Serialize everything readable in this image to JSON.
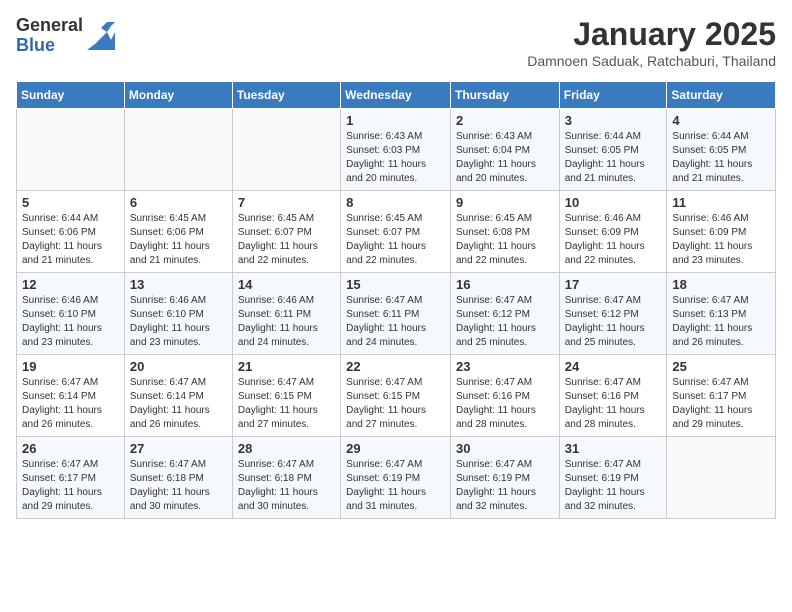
{
  "header": {
    "logo_general": "General",
    "logo_blue": "Blue",
    "month_title": "January 2025",
    "location": "Damnoen Saduak, Ratchaburi, Thailand"
  },
  "days_of_week": [
    "Sunday",
    "Monday",
    "Tuesday",
    "Wednesday",
    "Thursday",
    "Friday",
    "Saturday"
  ],
  "weeks": [
    [
      {
        "day": "",
        "info": ""
      },
      {
        "day": "",
        "info": ""
      },
      {
        "day": "",
        "info": ""
      },
      {
        "day": "1",
        "info": "Sunrise: 6:43 AM\nSunset: 6:03 PM\nDaylight: 11 hours and 20 minutes."
      },
      {
        "day": "2",
        "info": "Sunrise: 6:43 AM\nSunset: 6:04 PM\nDaylight: 11 hours and 20 minutes."
      },
      {
        "day": "3",
        "info": "Sunrise: 6:44 AM\nSunset: 6:05 PM\nDaylight: 11 hours and 21 minutes."
      },
      {
        "day": "4",
        "info": "Sunrise: 6:44 AM\nSunset: 6:05 PM\nDaylight: 11 hours and 21 minutes."
      }
    ],
    [
      {
        "day": "5",
        "info": "Sunrise: 6:44 AM\nSunset: 6:06 PM\nDaylight: 11 hours and 21 minutes."
      },
      {
        "day": "6",
        "info": "Sunrise: 6:45 AM\nSunset: 6:06 PM\nDaylight: 11 hours and 21 minutes."
      },
      {
        "day": "7",
        "info": "Sunrise: 6:45 AM\nSunset: 6:07 PM\nDaylight: 11 hours and 22 minutes."
      },
      {
        "day": "8",
        "info": "Sunrise: 6:45 AM\nSunset: 6:07 PM\nDaylight: 11 hours and 22 minutes."
      },
      {
        "day": "9",
        "info": "Sunrise: 6:45 AM\nSunset: 6:08 PM\nDaylight: 11 hours and 22 minutes."
      },
      {
        "day": "10",
        "info": "Sunrise: 6:46 AM\nSunset: 6:09 PM\nDaylight: 11 hours and 22 minutes."
      },
      {
        "day": "11",
        "info": "Sunrise: 6:46 AM\nSunset: 6:09 PM\nDaylight: 11 hours and 23 minutes."
      }
    ],
    [
      {
        "day": "12",
        "info": "Sunrise: 6:46 AM\nSunset: 6:10 PM\nDaylight: 11 hours and 23 minutes."
      },
      {
        "day": "13",
        "info": "Sunrise: 6:46 AM\nSunset: 6:10 PM\nDaylight: 11 hours and 23 minutes."
      },
      {
        "day": "14",
        "info": "Sunrise: 6:46 AM\nSunset: 6:11 PM\nDaylight: 11 hours and 24 minutes."
      },
      {
        "day": "15",
        "info": "Sunrise: 6:47 AM\nSunset: 6:11 PM\nDaylight: 11 hours and 24 minutes."
      },
      {
        "day": "16",
        "info": "Sunrise: 6:47 AM\nSunset: 6:12 PM\nDaylight: 11 hours and 25 minutes."
      },
      {
        "day": "17",
        "info": "Sunrise: 6:47 AM\nSunset: 6:12 PM\nDaylight: 11 hours and 25 minutes."
      },
      {
        "day": "18",
        "info": "Sunrise: 6:47 AM\nSunset: 6:13 PM\nDaylight: 11 hours and 26 minutes."
      }
    ],
    [
      {
        "day": "19",
        "info": "Sunrise: 6:47 AM\nSunset: 6:14 PM\nDaylight: 11 hours and 26 minutes."
      },
      {
        "day": "20",
        "info": "Sunrise: 6:47 AM\nSunset: 6:14 PM\nDaylight: 11 hours and 26 minutes."
      },
      {
        "day": "21",
        "info": "Sunrise: 6:47 AM\nSunset: 6:15 PM\nDaylight: 11 hours and 27 minutes."
      },
      {
        "day": "22",
        "info": "Sunrise: 6:47 AM\nSunset: 6:15 PM\nDaylight: 11 hours and 27 minutes."
      },
      {
        "day": "23",
        "info": "Sunrise: 6:47 AM\nSunset: 6:16 PM\nDaylight: 11 hours and 28 minutes."
      },
      {
        "day": "24",
        "info": "Sunrise: 6:47 AM\nSunset: 6:16 PM\nDaylight: 11 hours and 28 minutes."
      },
      {
        "day": "25",
        "info": "Sunrise: 6:47 AM\nSunset: 6:17 PM\nDaylight: 11 hours and 29 minutes."
      }
    ],
    [
      {
        "day": "26",
        "info": "Sunrise: 6:47 AM\nSunset: 6:17 PM\nDaylight: 11 hours and 29 minutes."
      },
      {
        "day": "27",
        "info": "Sunrise: 6:47 AM\nSunset: 6:18 PM\nDaylight: 11 hours and 30 minutes."
      },
      {
        "day": "28",
        "info": "Sunrise: 6:47 AM\nSunset: 6:18 PM\nDaylight: 11 hours and 30 minutes."
      },
      {
        "day": "29",
        "info": "Sunrise: 6:47 AM\nSunset: 6:19 PM\nDaylight: 11 hours and 31 minutes."
      },
      {
        "day": "30",
        "info": "Sunrise: 6:47 AM\nSunset: 6:19 PM\nDaylight: 11 hours and 32 minutes."
      },
      {
        "day": "31",
        "info": "Sunrise: 6:47 AM\nSunset: 6:19 PM\nDaylight: 11 hours and 32 minutes."
      },
      {
        "day": "",
        "info": ""
      }
    ]
  ]
}
